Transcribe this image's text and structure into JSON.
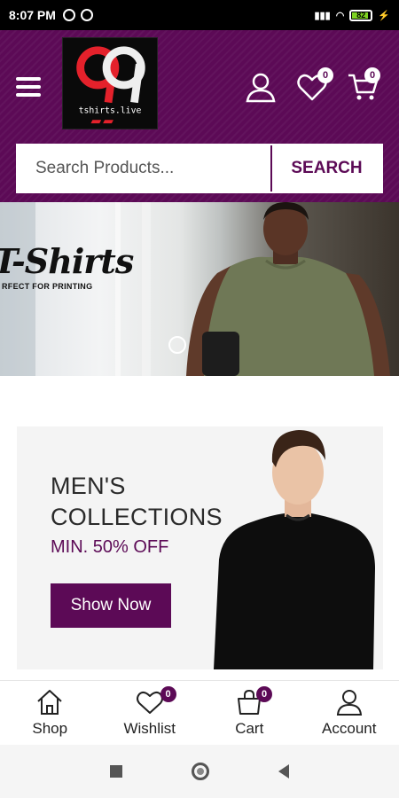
{
  "status_bar": {
    "time": "8:07 PM",
    "battery": "82"
  },
  "header": {
    "logo_text": "tshirts.live",
    "wishlist_count": "0",
    "cart_count": "0"
  },
  "search": {
    "placeholder": "Search Products...",
    "button_label": "SEARCH"
  },
  "hero": {
    "title": "T-Shirts",
    "subtitle": "RFECT FOR PRINTING"
  },
  "promo": {
    "title_line1": "MEN'S",
    "title_line2": "COLLECTIONS",
    "offer": "MIN. 50% OFF",
    "button_label": "Show Now"
  },
  "bottom_nav": {
    "items": [
      {
        "label": "Shop",
        "icon": "home-icon"
      },
      {
        "label": "Wishlist",
        "icon": "heart-icon",
        "badge": "0"
      },
      {
        "label": "Cart",
        "icon": "bag-icon",
        "badge": "0"
      },
      {
        "label": "Account",
        "icon": "user-icon"
      }
    ]
  },
  "colors": {
    "brand": "#5c0a56",
    "background": "#ffffff",
    "promo_bg": "#f4f4f4"
  }
}
